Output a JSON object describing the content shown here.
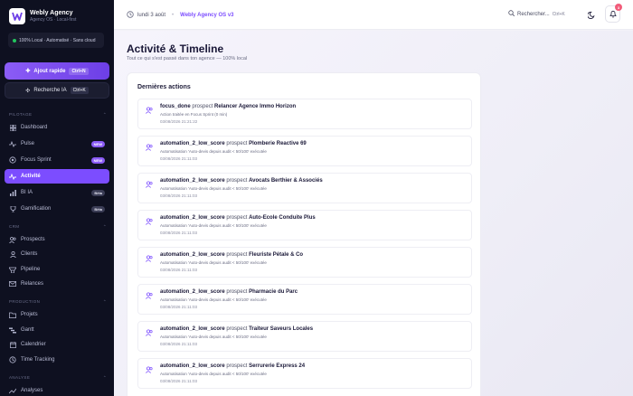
{
  "brand": {
    "name": "Webly Agency",
    "sub": "Agency OS · Local-first",
    "status": "100% Local · Automatisé · Sans cloud"
  },
  "sidebar": {
    "quick_label": "Ajout rapide",
    "quick_kbd": "Ctrl+N",
    "search_label": "Recherche IA",
    "search_kbd": "Ctrl+K",
    "sections": [
      {
        "label": "PILOTAGE",
        "items": [
          {
            "label": "Dashboard",
            "icon": "grid-icon"
          },
          {
            "label": "Pulse",
            "icon": "pulse-icon",
            "badge": "NEW"
          },
          {
            "label": "Focus Sprint",
            "icon": "target-icon",
            "badge": "NEW"
          },
          {
            "label": "Activité",
            "icon": "activity-icon",
            "active": true
          },
          {
            "label": "BI IA",
            "icon": "chart-icon",
            "badge": "Bêta"
          },
          {
            "label": "Gamification",
            "icon": "trophy-icon",
            "badge": "Bêta"
          }
        ]
      },
      {
        "label": "CRM",
        "items": [
          {
            "label": "Prospects",
            "icon": "users-icon"
          },
          {
            "label": "Clients",
            "icon": "user-icon"
          },
          {
            "label": "Pipeline",
            "icon": "pipeline-icon"
          },
          {
            "label": "Relances",
            "icon": "mail-icon"
          }
        ]
      },
      {
        "label": "PRODUCTION",
        "items": [
          {
            "label": "Projets",
            "icon": "folder-icon"
          },
          {
            "label": "Gantt",
            "icon": "gantt-icon"
          },
          {
            "label": "Calendrier",
            "icon": "calendar-icon"
          },
          {
            "label": "Time Tracking",
            "icon": "clock-icon"
          }
        ]
      },
      {
        "label": "ANALYSE",
        "items": [
          {
            "label": "Analyses",
            "icon": "analytics-icon"
          }
        ]
      }
    ]
  },
  "topbar": {
    "date": "lundi 3 août",
    "os_label": "Webly Agency OS v3",
    "search_label": "Rechercher...",
    "search_kbd": "Ctrl+K",
    "notif_count": "3"
  },
  "main": {
    "title": "Activité & Timeline",
    "subtitle": "Tout ce qui s'est passé dans ton agence — 100% local",
    "card_title": "Dernières actions",
    "actions": [
      {
        "type": "focus_done",
        "mid": "prospect",
        "target": "Relancer Agence Immo Horizon",
        "detail": "Action traitée en Focus Sprint (0 min)",
        "time": "03/08/2026 21:21:22"
      },
      {
        "type": "automation_2_low_score",
        "mid": "prospect",
        "target": "Plomberie Reactive 69",
        "detail": "Automatisation 'Auto-devis depuis audit < 50/100' exécutée",
        "time": "03/08/2026 21:11:03"
      },
      {
        "type": "automation_2_low_score",
        "mid": "prospect",
        "target": "Avocats Berthier & Associés",
        "detail": "Automatisation 'Auto-devis depuis audit < 50/100' exécutée",
        "time": "03/08/2026 21:11:03"
      },
      {
        "type": "automation_2_low_score",
        "mid": "prospect",
        "target": "Auto-Ecole Conduite Plus",
        "detail": "Automatisation 'Auto-devis depuis audit < 50/100' exécutée",
        "time": "03/08/2026 21:11:03"
      },
      {
        "type": "automation_2_low_score",
        "mid": "prospect",
        "target": "Fleuriste Pétale & Co",
        "detail": "Automatisation 'Auto-devis depuis audit < 50/100' exécutée",
        "time": "03/08/2026 21:11:03"
      },
      {
        "type": "automation_2_low_score",
        "mid": "prospect",
        "target": "Pharmacie du Parc",
        "detail": "Automatisation 'Auto-devis depuis audit < 50/100' exécutée",
        "time": "03/08/2026 21:11:03"
      },
      {
        "type": "automation_2_low_score",
        "mid": "prospect",
        "target": "Traiteur Saveurs Locales",
        "detail": "Automatisation 'Auto-devis depuis audit < 50/100' exécutée",
        "time": "03/08/2026 21:11:03"
      },
      {
        "type": "automation_2_low_score",
        "mid": "prospect",
        "target": "Serrurerie Express 24",
        "detail": "Automatisation 'Auto-devis depuis audit < 50/100' exécutée",
        "time": "03/08/2026 21:11:03"
      }
    ]
  },
  "colors": {
    "accent": "#7c4dff",
    "sidebar_bg": "#0e1020",
    "status_dot": "#22c55e",
    "notif": "#f25c7a"
  }
}
